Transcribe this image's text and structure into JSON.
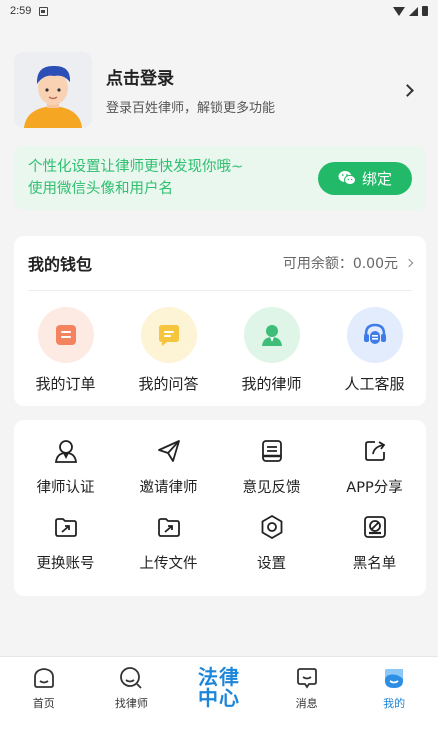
{
  "status_bar": {
    "time": "2:59"
  },
  "profile": {
    "title": "点击登录",
    "subtitle": "登录百姓律师，解锁更多功能"
  },
  "bind_card": {
    "line1": "个性化设置让律师更快发现你哦~",
    "line2": "使用微信头像和用户名",
    "button": "绑定"
  },
  "wallet": {
    "title": "我的钱包",
    "balance": "可用余额：0.00元",
    "items": [
      {
        "label": "我的订单",
        "icon": "order-icon",
        "color": "#f4845f"
      },
      {
        "label": "我的问答",
        "icon": "qa-icon",
        "color": "#f5c53d"
      },
      {
        "label": "我的律师",
        "icon": "lawyer-icon",
        "color": "#3dbd78"
      },
      {
        "label": "人工客服",
        "icon": "headset-icon",
        "color": "#3f7ce8"
      }
    ]
  },
  "tools": {
    "items": [
      {
        "label": "律师认证",
        "icon": "certify-icon"
      },
      {
        "label": "邀请律师",
        "icon": "invite-icon"
      },
      {
        "label": "意见反馈",
        "icon": "feedback-icon"
      },
      {
        "label": "APP分享",
        "icon": "share-icon"
      },
      {
        "label": "更换账号",
        "icon": "switch-account-icon"
      },
      {
        "label": "上传文件",
        "icon": "upload-icon"
      },
      {
        "label": "设置",
        "icon": "settings-icon"
      },
      {
        "label": "黑名单",
        "icon": "blacklist-icon"
      }
    ]
  },
  "nav": {
    "items": [
      {
        "label": "首页"
      },
      {
        "label": "找律师"
      },
      {
        "label": "法律中心",
        "line1": "法律",
        "line2": "中心"
      },
      {
        "label": "消息"
      },
      {
        "label": "我的"
      }
    ],
    "active_color": "#1e86d8"
  }
}
